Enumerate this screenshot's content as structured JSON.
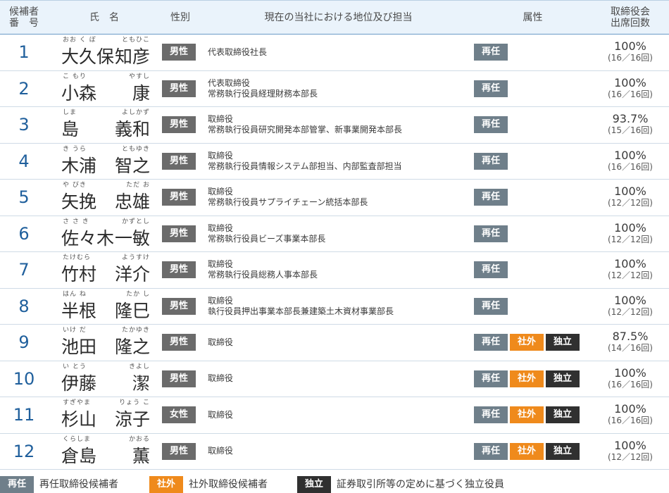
{
  "header": {
    "num_line1": "候補者",
    "num_line2": "番　号",
    "name": "氏　名",
    "gender": "性別",
    "position": "現在の当社における地位及び担当",
    "attribute": "属性",
    "attendance_line1": "取締役会",
    "attendance_line2": "出席回数"
  },
  "colors": {
    "reappoint": "#6f7f8a",
    "outside": "#ef8a1c",
    "independent": "#303030",
    "gender_badge": "#6b6b6b",
    "number": "#1f5f9c",
    "header_bg": "#eaf3fb"
  },
  "candidates": [
    {
      "num": "1",
      "family": "大久保",
      "given": "知彦",
      "family_ruby": "おお く ぼ",
      "given_ruby": "ともひこ",
      "gender": "男性",
      "position": [
        "代表取締役社長"
      ],
      "attrs": [
        "再任"
      ],
      "rate": "100%",
      "ratio": "(16／16回)"
    },
    {
      "num": "2",
      "family": "小森",
      "given": "康",
      "family_ruby": "こ もり",
      "given_ruby": "やすし",
      "gender": "男性",
      "position": [
        "代表取締役",
        "常務執行役員経理財務本部長"
      ],
      "attrs": [
        "再任"
      ],
      "rate": "100%",
      "ratio": "(16／16回)"
    },
    {
      "num": "3",
      "family": "島",
      "given": "義和",
      "family_ruby": "しま",
      "given_ruby": "よしかず",
      "gender": "男性",
      "position": [
        "取締役",
        "常務執行役員研究開発本部管掌、新事業開発本部長"
      ],
      "attrs": [
        "再任"
      ],
      "rate": "93.7%",
      "ratio": "(15／16回)"
    },
    {
      "num": "4",
      "family": "木浦",
      "given": "智之",
      "family_ruby": "き うら",
      "given_ruby": "ともゆき",
      "gender": "男性",
      "position": [
        "取締役",
        "常務執行役員情報システム部担当、内部監査部担当"
      ],
      "attrs": [
        "再任"
      ],
      "rate": "100%",
      "ratio": "(16／16回)"
    },
    {
      "num": "5",
      "family": "矢挽",
      "given": "忠雄",
      "family_ruby": "や びき",
      "given_ruby": "ただ お",
      "gender": "男性",
      "position": [
        "取締役",
        "常務執行役員サプライチェーン統括本部長"
      ],
      "attrs": [
        "再任"
      ],
      "rate": "100%",
      "ratio": "(12／12回)"
    },
    {
      "num": "6",
      "family": "佐々木",
      "given": "一敏",
      "family_ruby": "さ さ き",
      "given_ruby": "かずとし",
      "gender": "男性",
      "position": [
        "取締役",
        "常務執行役員ビーズ事業本部長"
      ],
      "attrs": [
        "再任"
      ],
      "rate": "100%",
      "ratio": "(12／12回)"
    },
    {
      "num": "7",
      "family": "竹村",
      "given": "洋介",
      "family_ruby": "たけむら",
      "given_ruby": "ようすけ",
      "gender": "男性",
      "position": [
        "取締役",
        "常務執行役員総務人事本部長"
      ],
      "attrs": [
        "再任"
      ],
      "rate": "100%",
      "ratio": "(12／12回)"
    },
    {
      "num": "8",
      "family": "半根",
      "given": "隆巳",
      "family_ruby": "はん ね",
      "given_ruby": "たか し",
      "gender": "男性",
      "position": [
        "取締役",
        "執行役員押出事業本部長兼建築土木資材事業部長"
      ],
      "attrs": [
        "再任"
      ],
      "rate": "100%",
      "ratio": "(12／12回)"
    },
    {
      "num": "9",
      "family": "池田",
      "given": "隆之",
      "family_ruby": "いけ だ",
      "given_ruby": "たかゆき",
      "gender": "男性",
      "position": [
        "取締役"
      ],
      "attrs": [
        "再任",
        "社外",
        "独立"
      ],
      "rate": "87.5%",
      "ratio": "(14／16回)"
    },
    {
      "num": "10",
      "family": "伊藤",
      "given": "潔",
      "family_ruby": "い とう",
      "given_ruby": "きよし",
      "gender": "男性",
      "position": [
        "取締役"
      ],
      "attrs": [
        "再任",
        "社外",
        "独立"
      ],
      "rate": "100%",
      "ratio": "(16／16回)"
    },
    {
      "num": "11",
      "family": "杉山",
      "given": "涼子",
      "family_ruby": "すぎやま",
      "given_ruby": "りょう こ",
      "gender": "女性",
      "position": [
        "取締役"
      ],
      "attrs": [
        "再任",
        "社外",
        "独立"
      ],
      "rate": "100%",
      "ratio": "(16／16回)"
    },
    {
      "num": "12",
      "family": "倉島",
      "given": "薫",
      "family_ruby": "くらしま",
      "given_ruby": "かおる",
      "gender": "男性",
      "position": [
        "取締役"
      ],
      "attrs": [
        "再任",
        "社外",
        "独立"
      ],
      "rate": "100%",
      "ratio": "(12／12回)"
    }
  ],
  "legend": [
    {
      "badge": "再任",
      "text": "再任取締役候補者"
    },
    {
      "badge": "社外",
      "text": "社外取締役候補者"
    },
    {
      "badge": "独立",
      "text": "証券取引所等の定めに基づく独立役員"
    }
  ]
}
